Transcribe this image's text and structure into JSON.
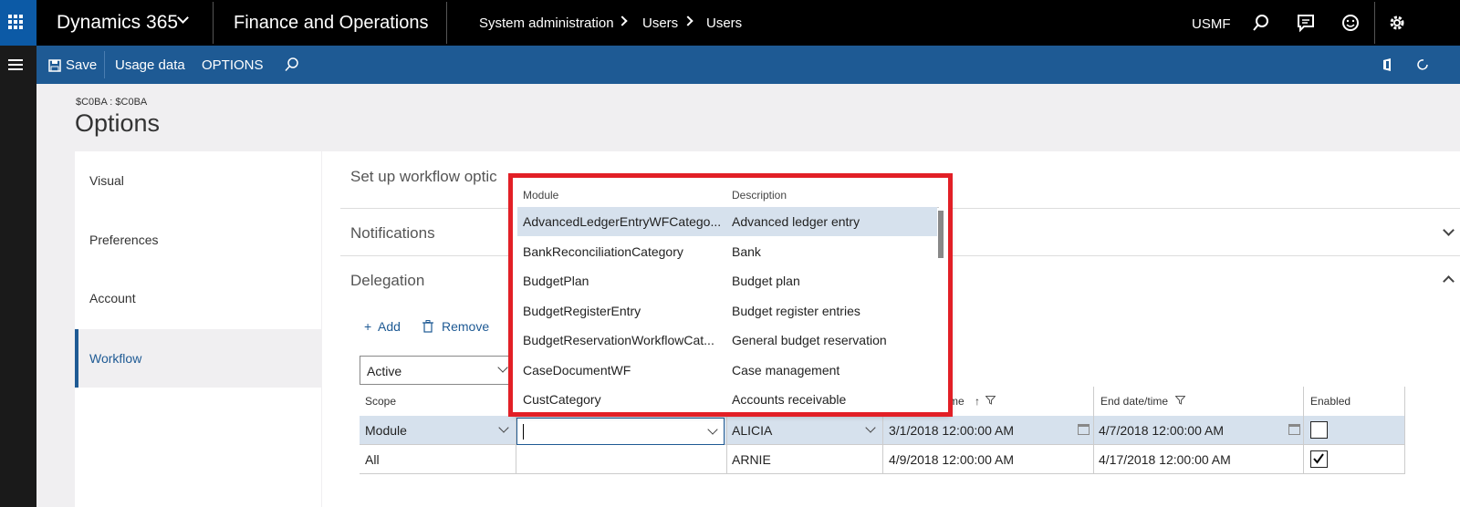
{
  "topbar": {
    "brand": "Dynamics 365",
    "app_name": "Finance and Operations",
    "breadcrumb": [
      "System administration",
      "Users",
      "Users"
    ],
    "company": "USMF"
  },
  "actionbar": {
    "save": "Save",
    "usage_data": "Usage data",
    "options": "OPTIONS"
  },
  "page": {
    "subtitle": "$C0BA : $C0BA",
    "title": "Options"
  },
  "nav": {
    "items": [
      "Visual",
      "Preferences",
      "Account",
      "Workflow"
    ],
    "active": "Workflow"
  },
  "main": {
    "setup_title": "Set up workflow optic",
    "notifications": "Notifications",
    "delegation": "Delegation",
    "add": "Add",
    "remove": "Remove",
    "filter_value": "Active"
  },
  "grid": {
    "headers": {
      "scope": "Scope",
      "start": "me",
      "end": "End date/time",
      "enabled": "Enabled"
    },
    "rows": [
      {
        "scope": "Module",
        "module": "",
        "user": "ALICIA",
        "start": "3/1/2018 12:00:00 AM",
        "end": "4/7/2018 12:00:00 AM",
        "enabled": false
      },
      {
        "scope": "All",
        "module": "",
        "user": "ARNIE",
        "start": "4/9/2018 12:00:00 AM",
        "end": "4/17/2018 12:00:00 AM",
        "enabled": true
      }
    ]
  },
  "dropdown": {
    "headers": {
      "module": "Module",
      "description": "Description"
    },
    "rows": [
      {
        "module": "AdvancedLedgerEntryWFCatego...",
        "description": "Advanced ledger entry"
      },
      {
        "module": "BankReconciliationCategory",
        "description": "Bank"
      },
      {
        "module": "BudgetPlan",
        "description": "Budget plan"
      },
      {
        "module": "BudgetRegisterEntry",
        "description": "Budget register entries"
      },
      {
        "module": "BudgetReservationWorkflowCat...",
        "description": "General budget reservation"
      },
      {
        "module": "CaseDocumentWF",
        "description": "Case management"
      },
      {
        "module": "CustCategory",
        "description": "Accounts receivable"
      }
    ]
  },
  "colors": {
    "topbar": "#000000",
    "waffle": "#0c5aa6",
    "actionbar": "#1e5a94",
    "accent": "#1e5a94",
    "highlight": "#e21f26",
    "selected_row": "#d6e1ed"
  }
}
